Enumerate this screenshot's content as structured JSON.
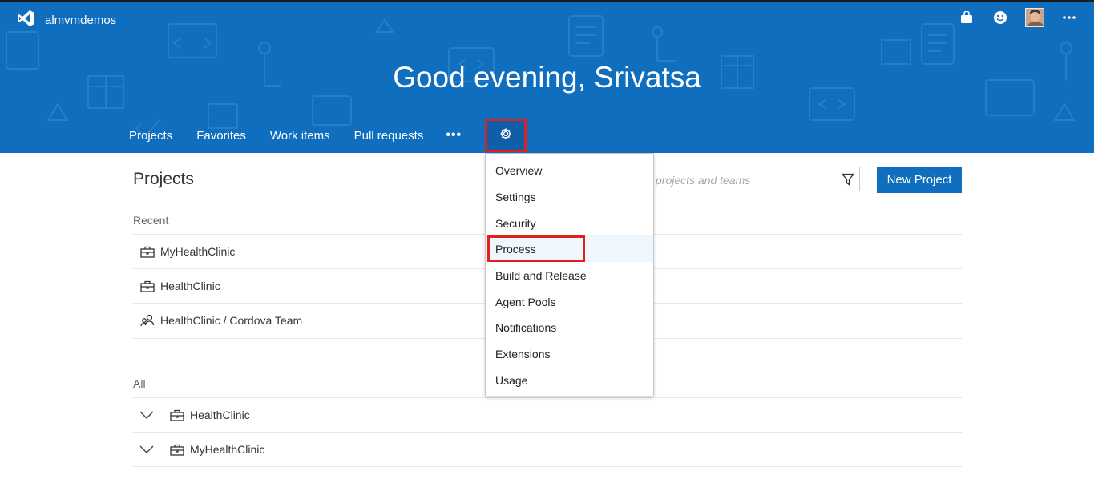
{
  "header": {
    "account_name": "almvmdemos",
    "greeting": "Good evening, Srivatsa",
    "logo_icon": "visual-studio-logo",
    "right_icons": [
      "marketplace-bag-icon",
      "smiley-feedback-icon",
      "user-avatar",
      "more-ellipsis-icon"
    ]
  },
  "hub_nav": {
    "items": [
      "Projects",
      "Favorites",
      "Work items",
      "Pull requests"
    ],
    "more": "•••",
    "settings_icon": "gear-icon"
  },
  "settings_menu": {
    "items": [
      "Overview",
      "Settings",
      "Security",
      "Process",
      "Build and Release",
      "Agent Pools",
      "Notifications",
      "Extensions",
      "Usage"
    ],
    "highlighted": "Process"
  },
  "main": {
    "title": "Projects",
    "search_placeholder": "projects and teams",
    "new_project_label": "New Project",
    "recent_label": "Recent",
    "recent": [
      {
        "name": "MyHealthClinic",
        "icon": "project-briefcase-icon"
      },
      {
        "name": "HealthClinic",
        "icon": "project-briefcase-icon"
      },
      {
        "name": "HealthClinic / Cordova Team",
        "icon": "team-people-icon"
      }
    ],
    "all_label": "All",
    "all": [
      {
        "name": "HealthClinic",
        "icon": "project-briefcase-icon"
      },
      {
        "name": "MyHealthClinic",
        "icon": "project-briefcase-icon"
      }
    ]
  },
  "colors": {
    "banner": "#106ebe",
    "accent": "#106ebe",
    "callout_red": "#e0201f",
    "menu_hover": "#eff6fc"
  }
}
